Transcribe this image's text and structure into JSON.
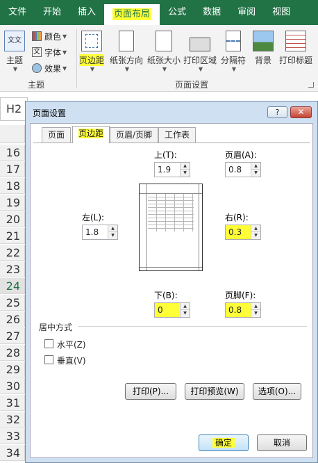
{
  "ribbon_tabs": [
    "文件",
    "开始",
    "插入",
    "页面布局",
    "公式",
    "数据",
    "审阅",
    "视图"
  ],
  "ribbon": {
    "theme_label": "主题",
    "colors_label": "颜色",
    "fonts_label": "字体",
    "effects_label": "效果",
    "group_theme": "主题",
    "margins_label": "页边距",
    "orientation_label": "纸张方向",
    "size_label": "纸张大小",
    "print_area_label": "打印区域",
    "breaks_label": "分隔符",
    "background_label": "背景",
    "print_titles_label": "打印标题",
    "group_page_setup": "页面设置"
  },
  "namebox": "H2",
  "rows": [
    "16",
    "17",
    "18",
    "19",
    "20",
    "21",
    "22",
    "23",
    "24",
    "25",
    "26",
    "27",
    "28",
    "29",
    "30",
    "31",
    "32",
    "33",
    "34"
  ],
  "selected_row": "24",
  "dialog": {
    "title": "页面设置",
    "help": "?",
    "close": "✕",
    "tabs": [
      "页面",
      "页边距",
      "页眉/页脚",
      "工作表"
    ],
    "active_tab": "页边距",
    "top_label": "上(T):",
    "top_value": "1.9",
    "header_label": "页眉(A):",
    "header_value": "0.8",
    "left_label": "左(L):",
    "left_value": "1.8",
    "right_label": "右(R):",
    "right_value": "0.3",
    "bottom_label": "下(B):",
    "bottom_value": "0",
    "footer_label": "页脚(F):",
    "footer_value": "0.8",
    "center_section": "居中方式",
    "horizontal_label": "水平(Z)",
    "vertical_label": "垂直(V)",
    "print_button": "打印(P)...",
    "preview_button": "打印预览(W)",
    "options_button": "选项(O)...",
    "ok_button": "确定",
    "cancel_button": "取消"
  },
  "colors": {
    "excel_green": "#217346",
    "highlight": "#ffff38"
  }
}
